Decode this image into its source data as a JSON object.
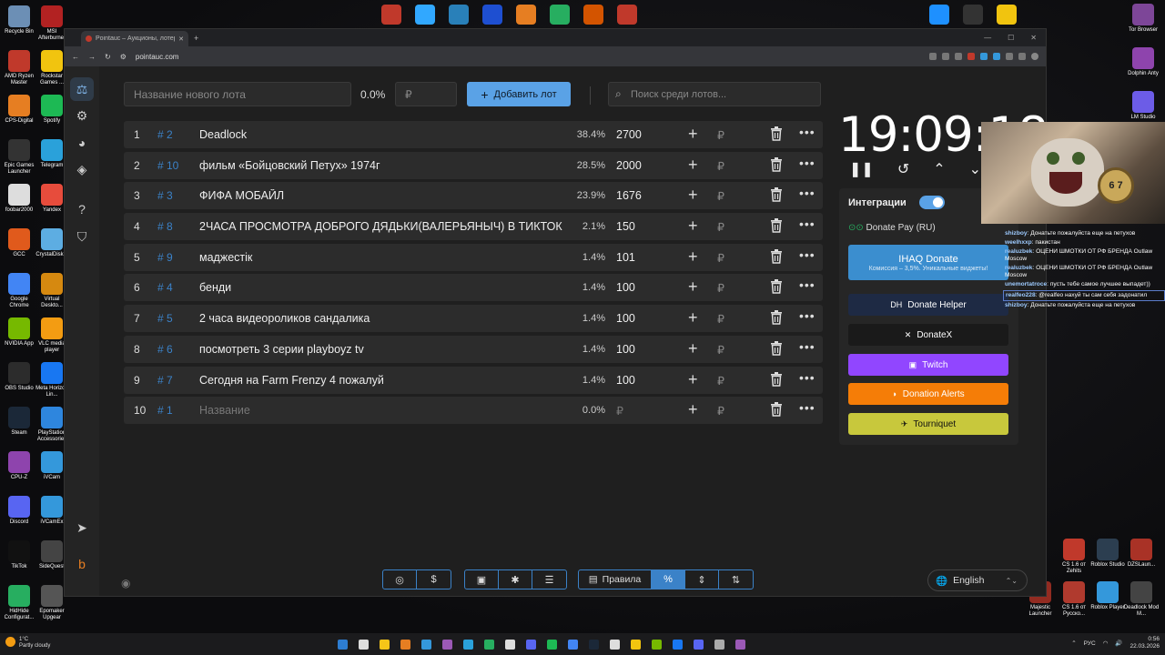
{
  "desktop": {
    "left_icons": [
      {
        "label": "Recycle Bin",
        "color": "#6c8fb5"
      },
      {
        "label": "MSI Afterburner",
        "color": "#b22222"
      },
      {
        "label": "AMD Ryzen Master",
        "color": "#c0392b"
      },
      {
        "label": "Rockstar Games ...",
        "color": "#f1c40f"
      },
      {
        "label": "CPS-Digital",
        "color": "#e67e22"
      },
      {
        "label": "Spotify",
        "color": "#1db954"
      },
      {
        "label": "Epic Games Launcher",
        "color": "#333333"
      },
      {
        "label": "Telegram",
        "color": "#2aa1da"
      },
      {
        "label": "foobar2000",
        "color": "#dddddd"
      },
      {
        "label": "Yandex",
        "color": "#e74c3c"
      },
      {
        "label": "GCC",
        "color": "#e05a1c"
      },
      {
        "label": "CrystalDisk...",
        "color": "#5dade2"
      },
      {
        "label": "Google Chrome",
        "color": "#4285f4"
      },
      {
        "label": "Virtual Deskto...",
        "color": "#d68910"
      },
      {
        "label": "NVIDIA App",
        "color": "#76b900"
      },
      {
        "label": "VLC media player",
        "color": "#f39c12"
      },
      {
        "label": "OBS Studio",
        "color": "#2c2c2c"
      },
      {
        "label": "Meta Horizon Lin...",
        "color": "#1877f2"
      },
      {
        "label": "Steam",
        "color": "#1b2838"
      },
      {
        "label": "PlayStation Accessories",
        "color": "#2e86de"
      },
      {
        "label": "CPU-Z",
        "color": "#8e44ad"
      },
      {
        "label": "iVCam",
        "color": "#3498db"
      },
      {
        "label": "Discord",
        "color": "#5865f2"
      },
      {
        "label": "iVCamEx",
        "color": "#3498db"
      },
      {
        "label": "TikTok",
        "color": "#111111"
      },
      {
        "label": "SideQuest",
        "color": "#444444"
      },
      {
        "label": "HidHide Configurat...",
        "color": "#27ae60"
      },
      {
        "label": "Epomaker Upgear",
        "color": "#555555"
      }
    ],
    "right_icons": [
      {
        "label": "Tor Browser",
        "color": "#7d4698"
      },
      {
        "label": "Dolphin Anty",
        "color": "#8e44ad"
      },
      {
        "label": "LM Studio",
        "color": "#6c5ce7"
      },
      {
        "label": "DeepL",
        "color": "#0f2b46"
      }
    ],
    "bottom_right_icons": [
      {
        "label": "CS 1.6 от Zehits",
        "color": "#c0392b"
      },
      {
        "label": "Roblox Studio",
        "color": "#2c3e50"
      },
      {
        "label": "DZSLaun...",
        "color": "#a93226"
      },
      {
        "label": "Majestic Launcher",
        "color": "#922b21"
      },
      {
        "label": "CS 1.6 от Русско...",
        "color": "#b03a2e"
      },
      {
        "label": "Roblox Player",
        "color": "#3498db"
      },
      {
        "label": "Deadlock Mod M...",
        "color": "#444444"
      }
    ],
    "top_icons": [
      "#c0392b",
      "#31a8ff",
      "#2980b9",
      "#1e4fd1",
      "#e67e22",
      "#27ae60",
      "#d35400",
      "#c0392b"
    ],
    "top_right_icons": [
      "#1e90ff",
      "#333333",
      "#f1c40f"
    ]
  },
  "browser": {
    "tab_title": "Pointauc – Аукционы, лотереи...",
    "url": "pointauc.com"
  },
  "app": {
    "new_lot_placeholder": "Название нового лота",
    "new_lot_percent": "0.0%",
    "amount_placeholder": "₽",
    "add_button": "Добавить лот",
    "search_placeholder": "Поиск среди лотов...",
    "lots": [
      {
        "num": "1",
        "id": "# 2",
        "name": "Deadlock",
        "pct": "38.4%",
        "amount": "2700"
      },
      {
        "num": "2",
        "id": "# 10",
        "name": "фильм «Бойцовский Петух» 1974г",
        "pct": "28.5%",
        "amount": "2000"
      },
      {
        "num": "3",
        "id": "# 3",
        "name": "ФИФА МОБАЙЛ",
        "pct": "23.9%",
        "amount": "1676"
      },
      {
        "num": "4",
        "id": "# 8",
        "name": "2ЧАСА ПРОСМОТРА ДОБРОГО ДЯДЬКИ(ВАЛЕРЬЯНЫЧ) В ТИКТОК",
        "pct": "2.1%",
        "amount": "150"
      },
      {
        "num": "5",
        "id": "# 9",
        "name": "маджестік",
        "pct": "1.4%",
        "amount": "101"
      },
      {
        "num": "6",
        "id": "# 4",
        "name": "бенди",
        "pct": "1.4%",
        "amount": "100"
      },
      {
        "num": "7",
        "id": "# 5",
        "name": "2 часа видеороликов сандалика",
        "pct": "1.4%",
        "amount": "100"
      },
      {
        "num": "8",
        "id": "# 6",
        "name": "посмотреть 3 серии playboyz tv",
        "pct": "1.4%",
        "amount": "100"
      },
      {
        "num": "9",
        "id": "# 7",
        "name": "Сегодня на Farm Frenzy 4 пожалуй",
        "pct": "1.4%",
        "amount": "100"
      },
      {
        "num": "10",
        "id": "# 1",
        "name": "Название",
        "pct": "0.0%",
        "amount": "₽",
        "placeholder": true
      }
    ],
    "currency": "₽",
    "timer": "19:09:18",
    "integrations": {
      "title": "Интеграции",
      "enabled": true,
      "donate_pay": "Donate Pay (RU)",
      "ihaq_title": "IHAQ Donate",
      "ihaq_sub": "Комиссия – 3,5%. Уникальные виджеты!",
      "buttons": [
        {
          "label": "Donate Helper",
          "color": "#1e2a44"
        },
        {
          "label": "DonateX",
          "color": "#1a1a1a"
        },
        {
          "label": "Twitch",
          "color": "#9146ff"
        },
        {
          "label": "Donation Alerts",
          "color": "#f57d07"
        },
        {
          "label": "Tourniquet",
          "color": "#c8c83c"
        }
      ]
    },
    "bottom_rules": "Правила",
    "language": "English"
  },
  "stream_overlay": {
    "cat_watch_text": "6 7",
    "chat": [
      {
        "user": "shizboy",
        "text": "Донатьте пожалуйста еще на петухов"
      },
      {
        "user": "weelhxxp",
        "text": "пакистан"
      },
      {
        "user": "realuzbek",
        "text": "ОЦЕНИ ШМОТКИ ОТ РФ БРЕНДА Outlaw Moscow"
      },
      {
        "user": "realuzbek",
        "text": "ОЦЕНИ ШМОТКИ ОТ РФ БРЕНДА Outlaw Moscow"
      },
      {
        "user": "unemortatroce",
        "text": "пусть тебе самое лучшее выпадет))"
      },
      {
        "user": "realfeo228",
        "text": "@realfeo нахуй ты сам себя задонатил",
        "highlight": true
      },
      {
        "user": "shizboy",
        "text": "Донатьте пожалуйста еще на петухов"
      }
    ]
  },
  "taskbar": {
    "weather_temp": "1°C",
    "weather_desc": "Partly cloudy",
    "lang": "РУС",
    "time": "0:56",
    "date": "22.03.2026",
    "icon_colors": [
      "#2d7dd2",
      "#dddddd",
      "#f5c518",
      "#e67e22",
      "#3498db",
      "#9b59b6",
      "#2aa1da",
      "#27ae60",
      "#dddddd",
      "#5865f2",
      "#1db954",
      "#4285f4",
      "#1b2838",
      "#dddddd",
      "#f1c40f",
      "#76b900",
      "#1877f2",
      "#5865f2",
      "#aaaaaa",
      "#9b59b6"
    ]
  }
}
